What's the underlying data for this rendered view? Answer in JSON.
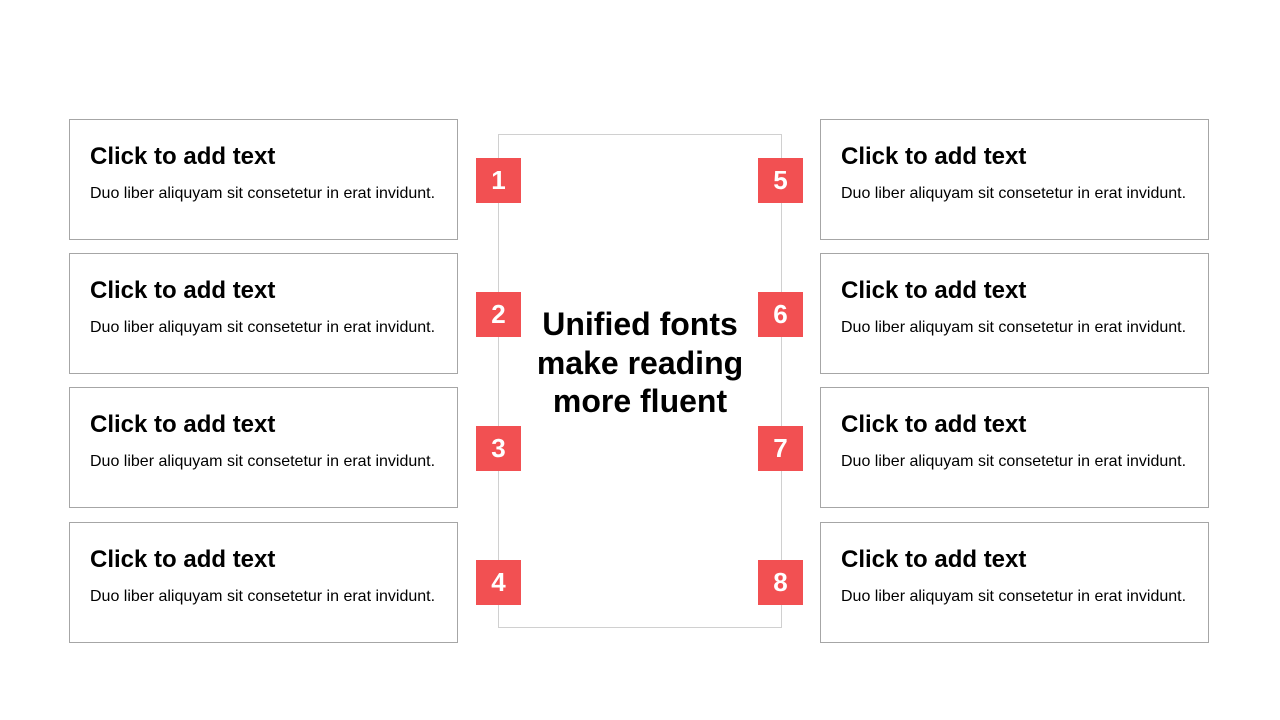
{
  "center": {
    "title": "Unified fonts make reading more fluent"
  },
  "colors": {
    "accent": "#f25052",
    "border": "#a6a6a6",
    "text": "#000000"
  },
  "left_items": [
    {
      "number": "1",
      "title": "Click to add text",
      "description": "Duo liber aliquyam sit consetetur in erat invidunt."
    },
    {
      "number": "2",
      "title": "Click to add text",
      "description": "Duo liber aliquyam sit consetetur in erat invidunt."
    },
    {
      "number": "3",
      "title": "Click to add text",
      "description": "Duo liber aliquyam sit consetetur in erat invidunt."
    },
    {
      "number": "4",
      "title": "Click to add text",
      "description": "Duo liber aliquyam sit consetetur in erat invidunt."
    }
  ],
  "right_items": [
    {
      "number": "5",
      "title": "Click to add text",
      "description": "Duo liber aliquyam sit consetetur in erat invidunt."
    },
    {
      "number": "6",
      "title": "Click to add text",
      "description": "Duo liber aliquyam sit consetetur in erat invidunt."
    },
    {
      "number": "7",
      "title": "Click to add text",
      "description": "Duo liber aliquyam sit consetetur in erat invidunt."
    },
    {
      "number": "8",
      "title": "Click to add text",
      "description": "Duo liber aliquyam sit consetetur in erat invidunt."
    }
  ]
}
